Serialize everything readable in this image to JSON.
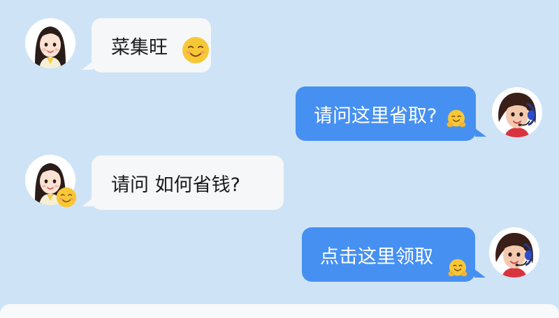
{
  "messages": [
    {
      "side": "incoming",
      "text": "菜集旺",
      "emoji": "smiling-face-icon"
    },
    {
      "side": "outgoing",
      "text": "请问这里省取?",
      "emoji": "hugging-face-icon"
    },
    {
      "side": "incoming",
      "text": "请问 如何省钱?",
      "emoji": "smiling-face-icon"
    },
    {
      "side": "outgoing",
      "text": "点击这里领取",
      "emoji": "hugging-face-icon"
    }
  ],
  "colors": {
    "background": "#cfe3f7",
    "incoming_bubble": "#f6f7f8",
    "outgoing_bubble": "#4690f2",
    "emoji_yellow": "#f7c736"
  }
}
